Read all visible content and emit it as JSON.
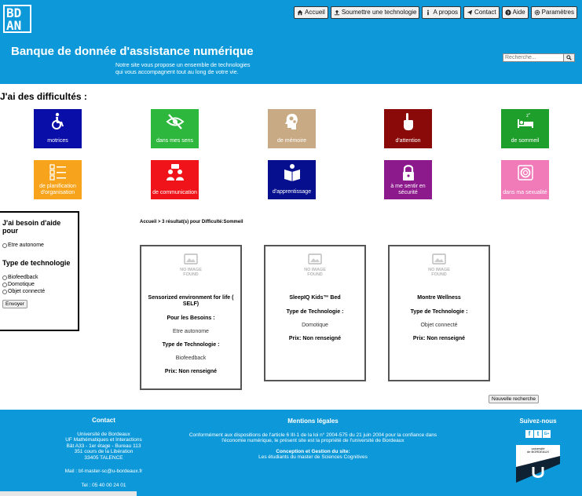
{
  "header": {
    "logo_line1": "BD",
    "logo_line2": "AN",
    "title": "Banque de donnée d'assistance numérique",
    "subtitle_line1": "Notre site vous propose un ensemble de technologies",
    "subtitle_line2": "qui vous accompagnent tout au long de votre vie.",
    "search_placeholder": "Recherche...",
    "nav": [
      {
        "label": "Accueil",
        "icon": "home-icon"
      },
      {
        "label": "Soumettre une technologie",
        "icon": "upload-icon"
      },
      {
        "label": "A propos",
        "icon": "info-icon"
      },
      {
        "label": "Contact",
        "icon": "send-icon"
      },
      {
        "label": "Aide",
        "icon": "question-icon"
      },
      {
        "label": "Paramètres",
        "icon": "gear-icon"
      }
    ]
  },
  "difficulties": {
    "title": "J'ai des difficultés :",
    "tiles": [
      {
        "label": "motrices",
        "color": "#0a0ea8",
        "icon": "wheelchair-icon"
      },
      {
        "label": "dans mes sens",
        "color": "#2db83d",
        "icon": "eye-slash-icon"
      },
      {
        "label": "de mémoire",
        "color": "#c8aa85",
        "icon": "head-gears-icon"
      },
      {
        "label": "d'attention",
        "color": "#8a0a0a",
        "icon": "pointing-hand-icon"
      },
      {
        "label": "de sommeil",
        "color": "#1e9e2a",
        "icon": "bed-icon"
      },
      {
        "label": "de planification d'organisation",
        "color": "#f7a41c",
        "icon": "checklist-icon"
      },
      {
        "label": "de communication",
        "color": "#f0141a",
        "icon": "people-talk-icon"
      },
      {
        "label": "d'apprentissage",
        "color": "#06108f",
        "icon": "reading-icon"
      },
      {
        "label": "à me sentir en sécurité",
        "color": "#8c1a8c",
        "icon": "padlock-icon"
      },
      {
        "label": "dans ma sexualité",
        "color": "#f07bb8",
        "icon": "condom-icon"
      }
    ]
  },
  "sidebar": {
    "help_title": "J'ai besoin d'aide pour",
    "help_options": [
      "Etre autonome"
    ],
    "tech_title": "Type de technologie",
    "tech_options": [
      "Biofeedback",
      "Domotique",
      "Objet connecté"
    ],
    "submit_label": "Envoyer"
  },
  "breadcrumb": "Accueil > 3 résultat(s) pour Difficulté:Sommeil",
  "no_image_text_line1": "NO IMAGE",
  "no_image_text_line2": "FOUND",
  "results": [
    {
      "title": "Sensorized environment for life ( SELF)",
      "needs_label": "Pour les Besoins :",
      "needs_value": "Etre autonome",
      "type_label": "Type de Technologie :",
      "type_value": "Biofeedback",
      "price": "Prix: Non renseigné"
    },
    {
      "title": "SleepIQ Kids™ Bed",
      "type_label": "Type de Technologie :",
      "type_value": "Domotique",
      "price": "Prix: Non renseigné"
    },
    {
      "title": "Montre Wellness",
      "type_label": "Type de Technologie :",
      "type_value": "Objet connecté",
      "price": "Prix: Non renseigné"
    }
  ],
  "new_search_label": "Nouvelle recherche",
  "footer": {
    "contact_title": "Contact",
    "contact_lines": [
      "Université de Bordeaux",
      "UF Mathématiques et Interactions",
      "Bât A33 - 1er étage - Bureau 113",
      "351 cours de la Libération",
      "33405 TALENCE"
    ],
    "mail": "Mail : bf-master-sc@u-bordeaux.fr",
    "tel": "Tel : 05 40 00 24 01",
    "legal_title": "Mentions légales",
    "legal_text": "Conformément aux dispositions de l'article 6 III-1 de la loi n° 2004-575 du 21 juin 2004 pour la confiance dans l'économie numérique, le présent site est la propriété de l'université de Bordeaux",
    "design_title": "Conception et Gestion du site:",
    "design_text": "Les étudiants du master de Sciences Cognitives",
    "follow_title": "Suivez-nous",
    "social": [
      "f",
      "t",
      "G+"
    ],
    "univ_logo_text_line1": "université",
    "univ_logo_text_line2": "de BORDEAUX"
  }
}
